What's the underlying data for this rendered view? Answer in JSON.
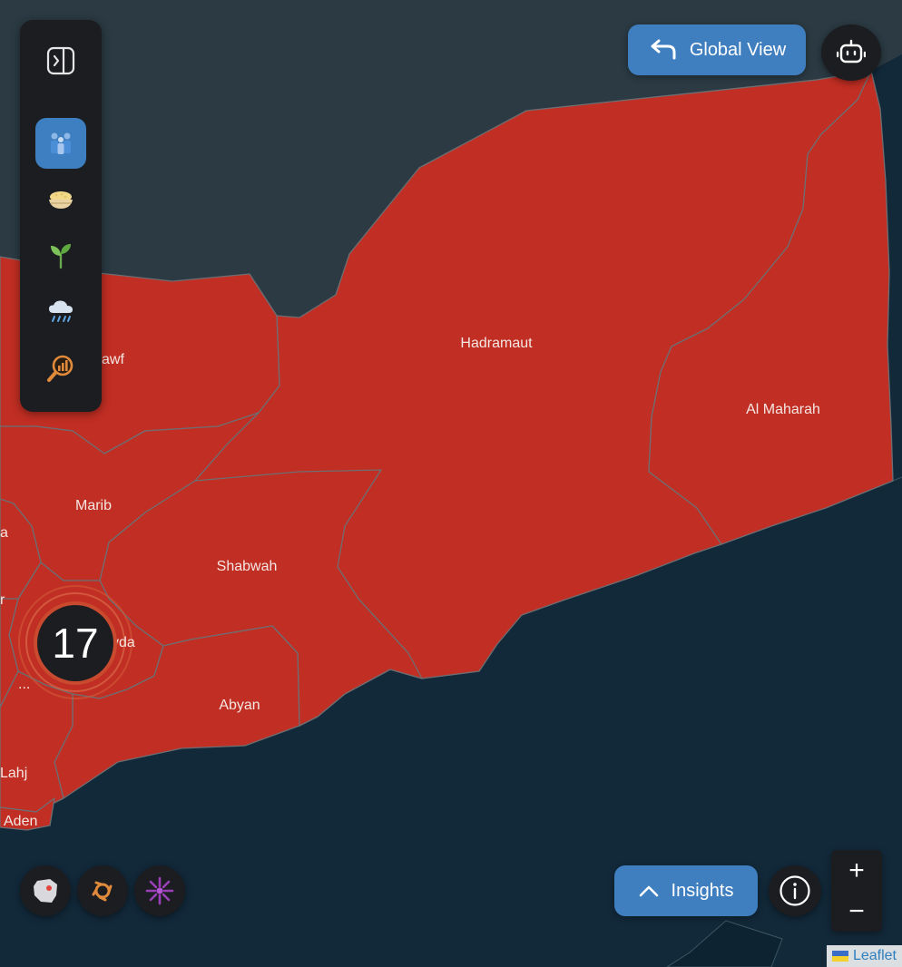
{
  "map": {
    "regions": [
      {
        "label": "Hadramaut"
      },
      {
        "label": "Al Maharah"
      },
      {
        "label": "Marib"
      },
      {
        "label": "Shabwah"
      },
      {
        "label": "Abyan"
      },
      {
        "label": "Lahj"
      },
      {
        "label": "Aden"
      },
      {
        "label": "awf"
      },
      {
        "label": "yda"
      },
      {
        "label": "..."
      },
      {
        "label": "a"
      },
      {
        "label": "r"
      }
    ],
    "cluster_count": "17",
    "fill_color": "#c12e23",
    "land_dark_color": "#2b3a43",
    "sea_color": "#12293a"
  },
  "toolbar": {
    "items": [
      {
        "icon": "sidebar-toggle-icon"
      },
      {
        "icon": "population-icon",
        "active": true
      },
      {
        "icon": "food-bowl-icon"
      },
      {
        "icon": "seedling-icon"
      },
      {
        "icon": "rain-cloud-icon"
      },
      {
        "icon": "analytics-search-icon"
      }
    ]
  },
  "header": {
    "global_view_label": "Global View",
    "chatbot_icon": "robot-icon"
  },
  "footer": {
    "insights_label": "Insights",
    "info_icon": "info-icon",
    "zoom_in": "+",
    "zoom_out": "−",
    "layers": [
      {
        "icon": "country-shape-icon"
      },
      {
        "icon": "hazard-spiral-icon"
      },
      {
        "icon": "conflict-burst-icon"
      }
    ]
  },
  "attribution": {
    "link_text": "Leaflet"
  }
}
